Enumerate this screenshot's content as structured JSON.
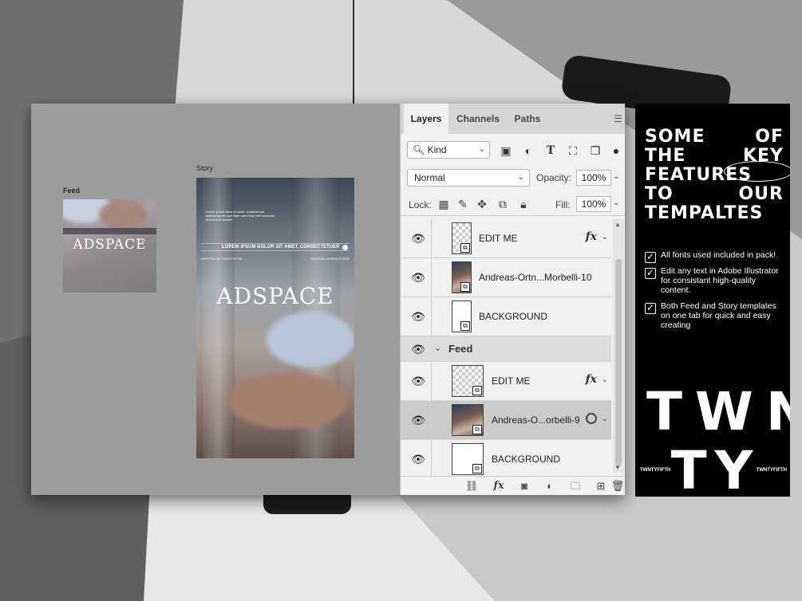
{
  "canvas": {
    "feed_label": "Feed",
    "story_label": "Story",
    "feed_logo": "ADSPACE",
    "story_logo": "ADSPACE",
    "story_bar_text": "LOREM IPSUM DOLOR SIT AMET, CONSECTETUER",
    "story_body_text": "Lorem ipsum dolor sit amet, consectetuer adipiscing elit, sed diam nonummy nibh euismod tincidunt ut laoreet",
    "story_credit_left": "WRITTEN BY TWNTYFIFTH",
    "story_credit_right": "TUESDAY, ADSPACE 2025"
  },
  "layers_panel": {
    "tabs": [
      "Layers",
      "Channels",
      "Paths"
    ],
    "active_tab": "Layers",
    "kind_filter": "Kind",
    "blend_mode": "Normal",
    "opacity_label": "Opacity:",
    "opacity_value": "100%",
    "lock_label": "Lock:",
    "fill_label": "Fill:",
    "fill_value": "100%",
    "layers": [
      {
        "name": "EDIT ME",
        "type": "smart",
        "fx": "fx"
      },
      {
        "name": "Andreas-Ortn...Morbelli-10",
        "type": "photo"
      },
      {
        "name": "BACKGROUND",
        "type": "smart"
      },
      {
        "name": "Feed",
        "type": "group"
      },
      {
        "name": "EDIT ME",
        "type": "smart",
        "fx": "fx"
      },
      {
        "name": "Andreas-O...orbelli-9",
        "type": "photo",
        "selected": true
      },
      {
        "name": "BACKGROUND",
        "type": "smart"
      }
    ]
  },
  "promo": {
    "headline_rows": [
      [
        "SOME",
        "OF"
      ],
      [
        "THE",
        "KEY"
      ],
      [
        "FEATURES"
      ],
      [
        "TO",
        "OUR"
      ],
      [
        "TEMPALTES"
      ]
    ],
    "features": [
      "All fonts used included in pack!",
      "Edit any text in Adobe Illustrator for consistant high-quality content.",
      "Both Feed and Story templates on one tab for quick and easy creating"
    ],
    "brand_line1": "TWN",
    "brand_line2": "TY",
    "brand_small_left": "TWNTYFIFTH",
    "brand_small_right": "TWNTYFIFTH"
  },
  "colors": {
    "panel_bg": "#f0f0f0",
    "tab_bar": "#d6d6d6",
    "selected_row": "#cbcbcb",
    "promo_bg": "#000000",
    "canvas_bg": "#9c9c9c"
  }
}
